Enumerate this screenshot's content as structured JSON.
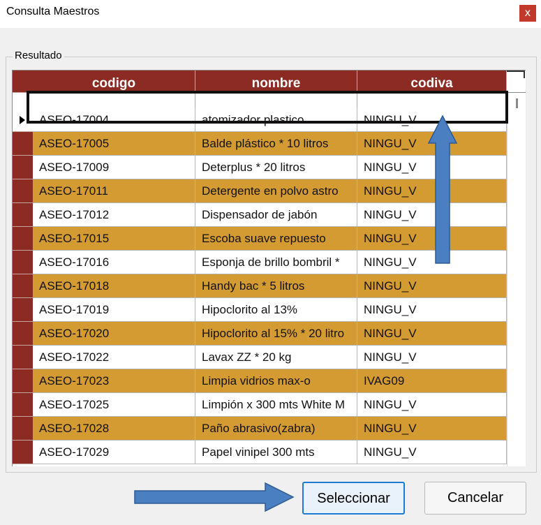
{
  "window": {
    "title": "Consulta Maestros",
    "close_glyph": "x"
  },
  "group": {
    "label": "Resultado"
  },
  "columns": [
    "codigo",
    "nombre",
    "codiva"
  ],
  "rows": [
    {
      "codigo": "ASEO-17004",
      "nombre": "atomizador plastico",
      "codiva": "NINGU_V"
    },
    {
      "codigo": "ASEO-17005",
      "nombre": "Balde plástico * 10 litros",
      "codiva": "NINGU_V"
    },
    {
      "codigo": "ASEO-17009",
      "nombre": "Deterplus * 20 litros",
      "codiva": "NINGU_V"
    },
    {
      "codigo": "ASEO-17011",
      "nombre": "Detergente en polvo astro",
      "codiva": "NINGU_V"
    },
    {
      "codigo": "ASEO-17012",
      "nombre": "Dispensador de jabón",
      "codiva": "NINGU_V"
    },
    {
      "codigo": "ASEO-17015",
      "nombre": "Escoba suave repuesto",
      "codiva": "NINGU_V"
    },
    {
      "codigo": "ASEO-17016",
      "nombre": "Esponja de brillo bombril *",
      "codiva": "NINGU_V"
    },
    {
      "codigo": "ASEO-17018",
      "nombre": "Handy bac * 5 litros",
      "codiva": "NINGU_V"
    },
    {
      "codigo": "ASEO-17019",
      "nombre": "Hipoclorito al 13%",
      "codiva": "NINGU_V"
    },
    {
      "codigo": "ASEO-17020",
      "nombre": "Hipoclorito al 15% * 20 litro",
      "codiva": "NINGU_V"
    },
    {
      "codigo": "ASEO-17022",
      "nombre": "Lavax ZZ * 20 kg",
      "codiva": "NINGU_V"
    },
    {
      "codigo": "ASEO-17023",
      "nombre": "Limpia vidrios max-o",
      "codiva": "IVAG09"
    },
    {
      "codigo": "ASEO-17025",
      "nombre": "Limpión x 300 mts White M",
      "codiva": "NINGU_V"
    },
    {
      "codigo": "ASEO-17028",
      "nombre": "Paño abrasivo(zabra)",
      "codiva": "NINGU_V"
    },
    {
      "codigo": "ASEO-17029",
      "nombre": "Papel vinipel 300 mts",
      "codiva": "NINGU_V"
    }
  ],
  "buttons": {
    "select": "Seleccionar",
    "cancel": "Cancelar"
  },
  "icons": {
    "filter": "filter-clear-icon",
    "current_row": "row-pointer-icon",
    "close": "close-icon"
  },
  "colors": {
    "header": "#8c2b24",
    "alt_row": "#d59b33",
    "annotation_arrow": "#4a7fc1",
    "close_button": "#c0392b"
  }
}
